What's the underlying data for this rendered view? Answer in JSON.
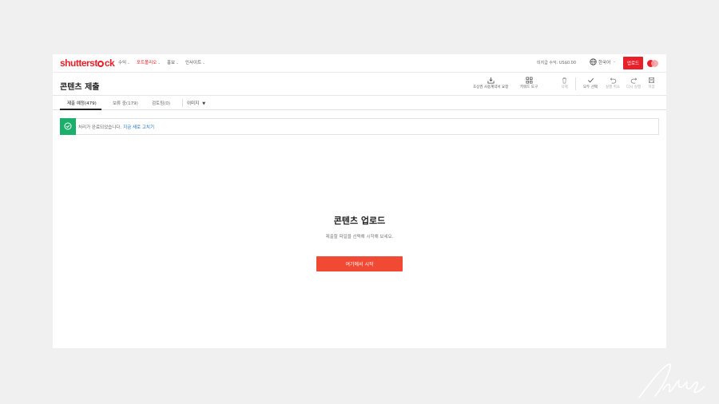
{
  "brand": {
    "logo_pre": "shutterst",
    "logo_post": "ck"
  },
  "nav": {
    "menu": [
      {
        "label": "수익",
        "active": false
      },
      {
        "label": "포트폴리오",
        "active": true
      },
      {
        "label": "홍보",
        "active": false
      },
      {
        "label": "인사이트",
        "active": false
      }
    ],
    "earnings": "미지급 수익: US$0.00",
    "language": "한국어",
    "upload": "업로드"
  },
  "header": {
    "title": "콘텐츠 제출",
    "tools": {
      "release": "초상권 사용계약서 요청",
      "keyword": "키워드 도구",
      "delete": "삭제",
      "select_all": "모두 선택",
      "undo": "실행 취소",
      "redo": "다시 실행",
      "save": "저장"
    }
  },
  "tabs": {
    "pending": "제출 예정(479)",
    "hold": "보류 중(179)",
    "reviewed": "검토됨(0)",
    "filter": "이미지"
  },
  "alert": {
    "text": "처리가 완료되었습니다.",
    "link": "지금 새로 고치기"
  },
  "empty": {
    "title": "콘텐츠 업로드",
    "subtitle": "제출할 파일을 선택해 시작해 보세요.",
    "button": "여기에서 시작"
  },
  "colors": {
    "accent": "#e8202a",
    "success": "#1ab06b",
    "link": "#1a73c4",
    "cta": "#f04a35"
  }
}
